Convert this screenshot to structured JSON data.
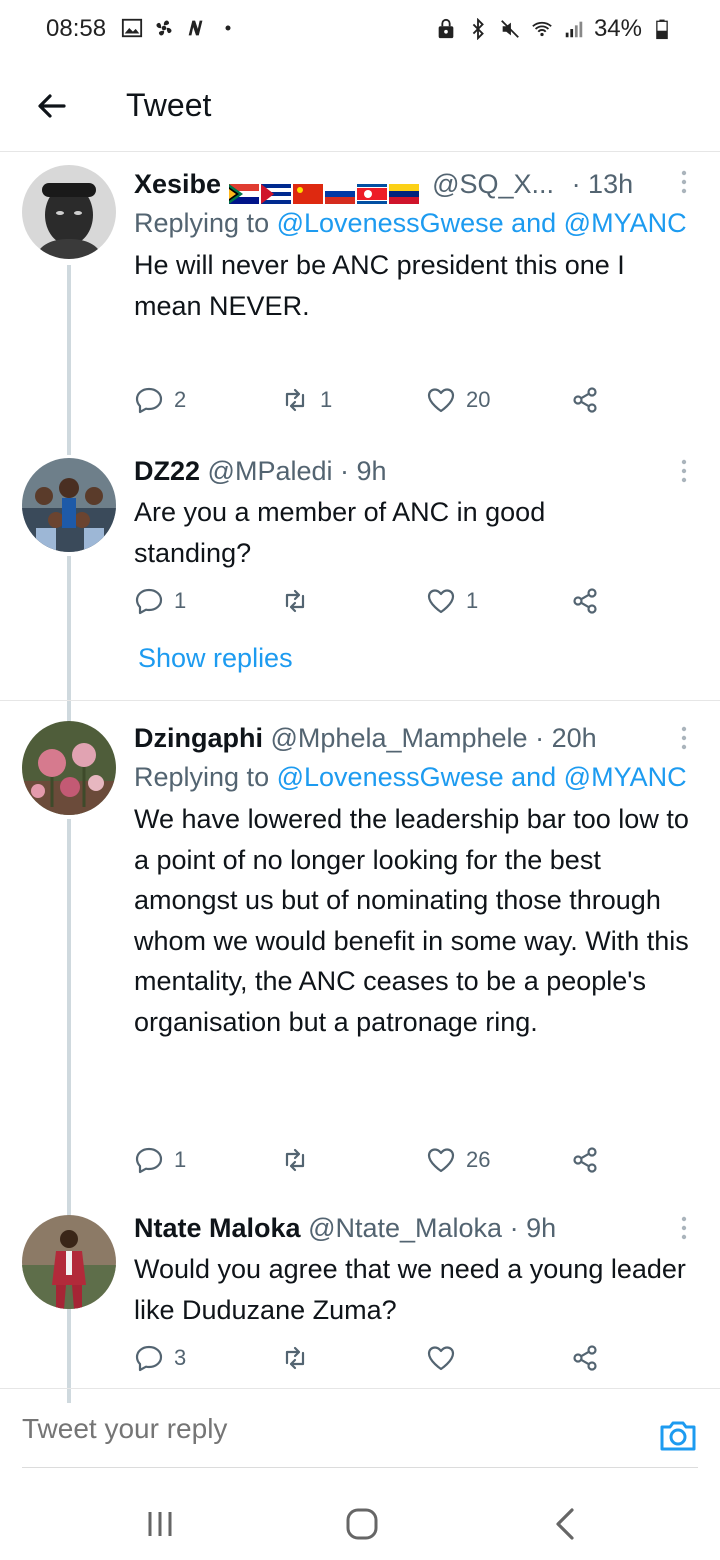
{
  "status_bar": {
    "time": "08:58",
    "battery": "34%"
  },
  "header": {
    "title": "Tweet"
  },
  "tweets": [
    {
      "name": "Xesibe",
      "handle": "@SQ_X...",
      "time": "· 13h",
      "replying_prefix": "Replying to",
      "replying_to": "@LovenessGwese and @MYANC",
      "text": "He will never be ANC president this one I mean NEVER.",
      "replies": "2",
      "retweets": "1",
      "likes": "20"
    },
    {
      "name": "DZ22",
      "handle": "@MPaledi",
      "time": "· 9h",
      "text": "Are you a member of ANC in good standing?",
      "replies": "1",
      "retweets": "",
      "likes": "1"
    },
    {
      "name": "Dzingaphi",
      "handle": "@Mphela_Mamphele",
      "time": "· 20h",
      "replying_prefix": "Replying to",
      "replying_to": "@LovenessGwese and @MYANC",
      "text": "We have lowered the leadership bar too low to a point of no longer looking for the best amongst us but of nominating those through whom we would benefit in some way. With this mentality, the ANC ceases to be a people's organisation but a patronage ring.",
      "replies": "1",
      "retweets": "",
      "likes": "26"
    },
    {
      "name": "Ntate Maloka",
      "handle": "@Ntate_Maloka",
      "time": "· 9h",
      "text": "Would you agree that we need a young leader like Duduzane Zuma?",
      "replies": "3",
      "retweets": "",
      "likes": ""
    }
  ],
  "show_replies": "Show replies",
  "reply_bar": {
    "placeholder": "Tweet your reply"
  },
  "colors": {
    "accent": "#1d9bf0",
    "text": "#0f1419",
    "muted": "#536471"
  }
}
